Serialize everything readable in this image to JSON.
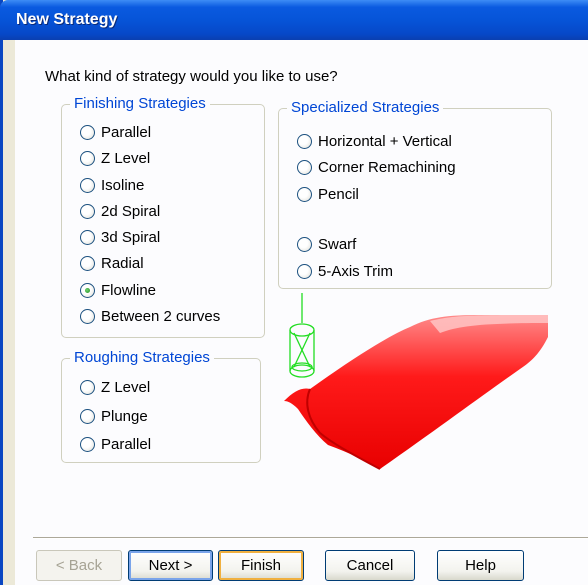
{
  "window": {
    "title": "New Strategy"
  },
  "prompt": "What kind of strategy would you like to use?",
  "finishing": {
    "title": "Finishing Strategies",
    "options": [
      "Parallel",
      "Z Level",
      "Isoline",
      "2d Spiral",
      "3d Spiral",
      "Radial",
      "Flowline",
      "Between 2 curves"
    ],
    "selected": "Flowline"
  },
  "roughing": {
    "title": "Roughing Strategies",
    "options": [
      "Z Level",
      "Plunge",
      "Parallel"
    ]
  },
  "specialized": {
    "title": "Specialized Strategies",
    "options": [
      "Horizontal + Vertical",
      "Corner Remachining",
      "Pencil",
      "Swarf",
      "5-Axis Trim"
    ]
  },
  "buttons": {
    "back": "< Back",
    "next": "Next >",
    "finish": "Finish",
    "cancel": "Cancel",
    "help": "Help"
  },
  "colors": {
    "title_bar": "#0654d8",
    "group_title": "#0046d5",
    "preview_surface": "#ee0000",
    "preview_tool": "#22dd22"
  },
  "icons": {
    "selected_radio": "radio-checked",
    "unselected_radio": "radio-unchecked"
  }
}
